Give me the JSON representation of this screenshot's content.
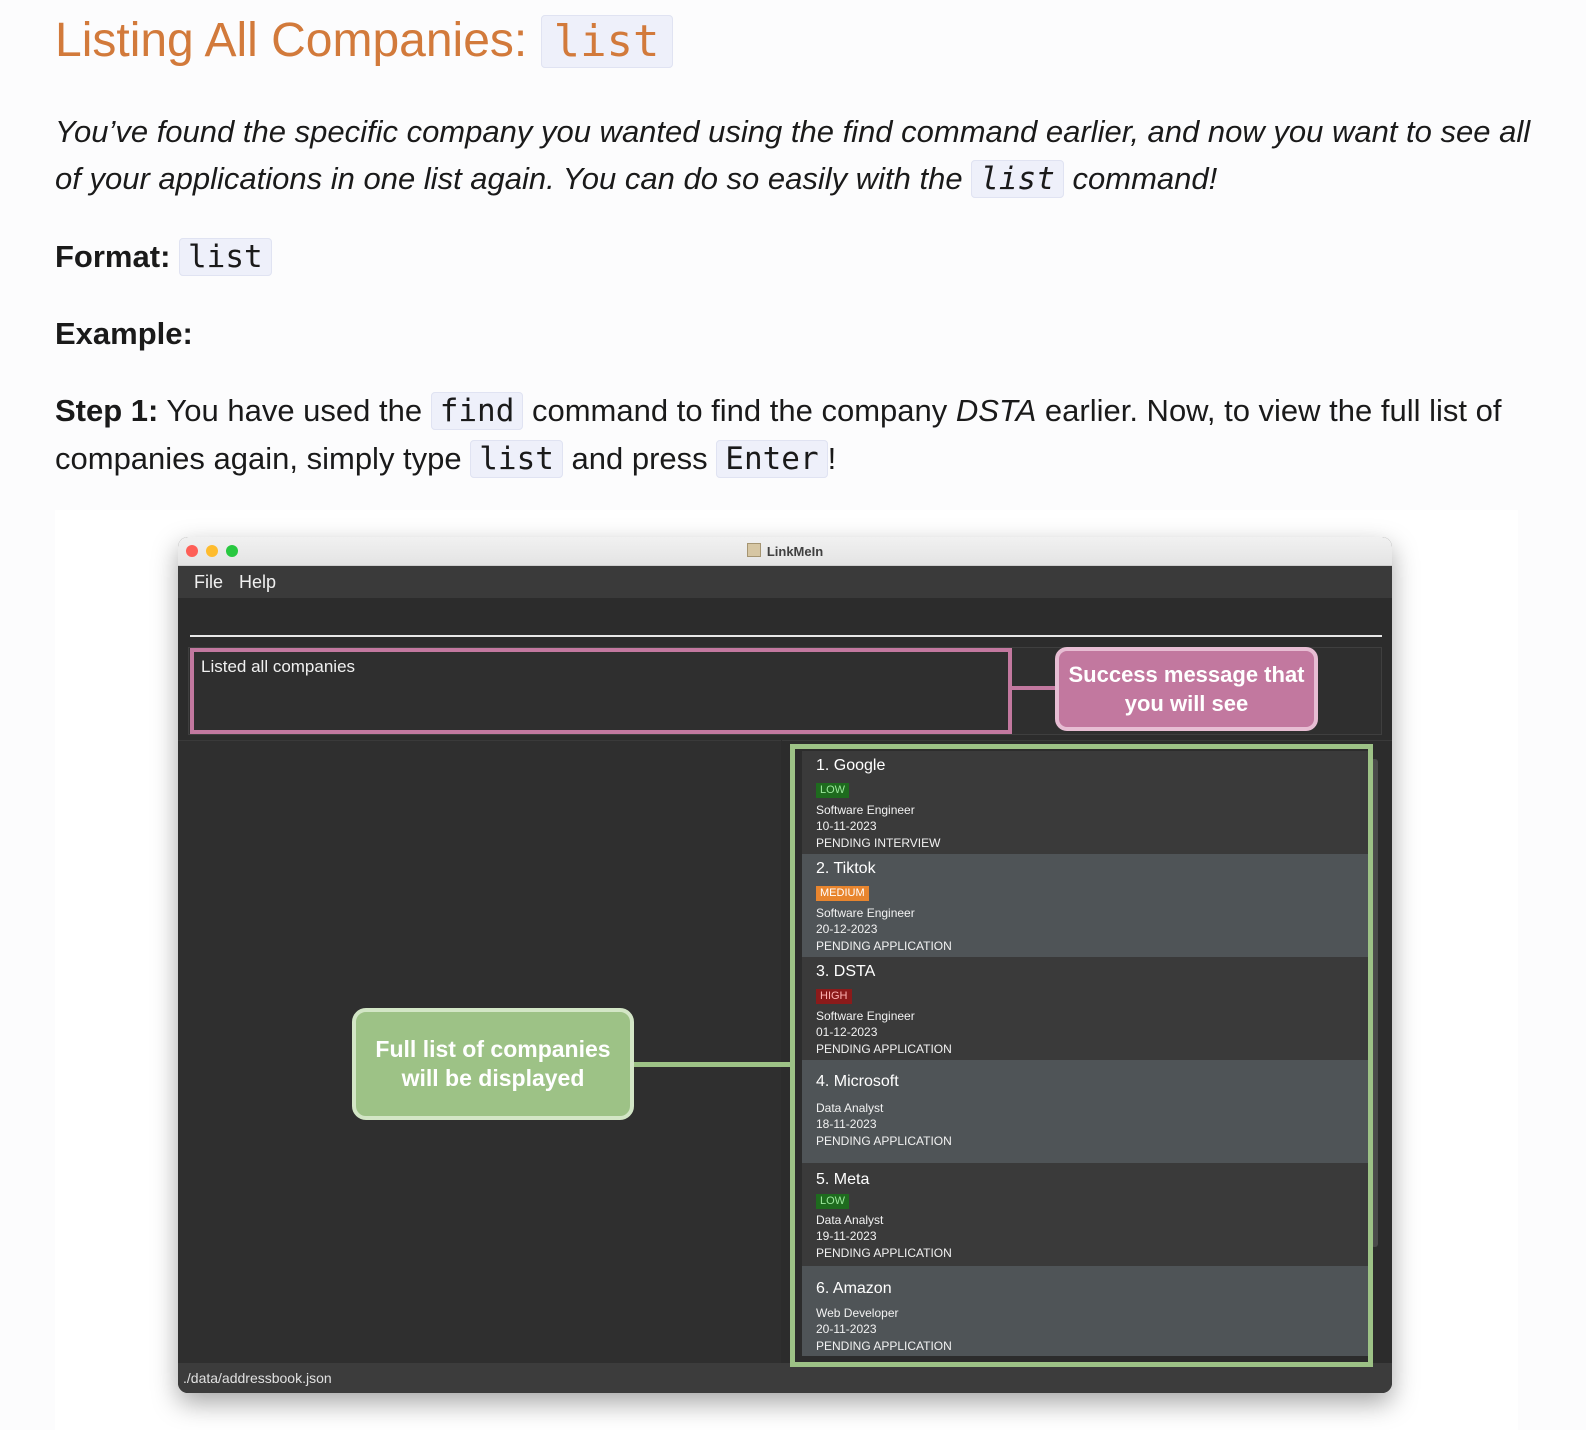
{
  "heading": {
    "text": "Listing All Companies: ",
    "code": "list"
  },
  "intro": {
    "before": "You’ve found the specific company you wanted using the find command earlier, and now you want to see all of your applications in one list again. You can do so easily with the ",
    "code": "list",
    "after": " command!"
  },
  "format": {
    "label": "Format:",
    "code": "list"
  },
  "example": {
    "label": "Example:"
  },
  "step1": {
    "label": "Step 1:",
    "t1": " You have used the ",
    "code1": "find",
    "t2": " command to find the company ",
    "company": "DSTA",
    "t3": " earlier. Now, to view the full list of companies again, simply type ",
    "code2": "list",
    "t4": " and press ",
    "code3": "Enter",
    "t5": "!"
  },
  "app": {
    "window_title": "LinkMeIn",
    "menu": [
      "File",
      "Help"
    ],
    "result_message": "Listed all companies",
    "status_bar": "./data/addressbook.json",
    "companies": [
      {
        "name": "1.  Google",
        "priority": "LOW",
        "role": "Software Engineer",
        "date": "10-11-2023",
        "status": "PENDING INTERVIEW"
      },
      {
        "name": "2.  Tiktok",
        "priority": "MEDIUM",
        "role": "Software Engineer",
        "date": "20-12-2023",
        "status": "PENDING APPLICATION"
      },
      {
        "name": "3.  DSTA",
        "priority": "HIGH",
        "role": "Software Engineer",
        "date": "01-12-2023",
        "status": "PENDING APPLICATION"
      },
      {
        "name": "4.  Microsoft",
        "priority": "",
        "role": "Data Analyst",
        "date": "18-11-2023",
        "status": "PENDING APPLICATION"
      },
      {
        "name": "5.  Meta",
        "priority": "LOW",
        "role": "Data Analyst",
        "date": "19-11-2023",
        "status": "PENDING APPLICATION"
      },
      {
        "name": "6.  Amazon",
        "priority": "",
        "role": "Web Developer",
        "date": "20-11-2023",
        "status": "PENDING APPLICATION"
      }
    ],
    "priority_colors": {
      "LOW": "#1e6b1e",
      "MEDIUM": "#e8852e",
      "HIGH": "#8b1a1a"
    }
  },
  "annotations": {
    "success": "Success message that you will see",
    "full_list": "Full list of companies will be displayed"
  }
}
